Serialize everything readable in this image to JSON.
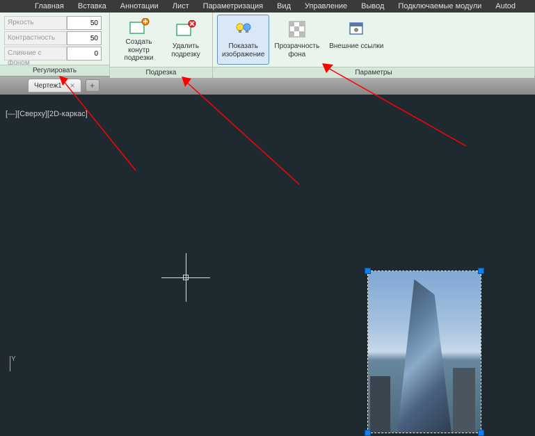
{
  "menubar": {
    "items": [
      "Главная",
      "Вставка",
      "Аннотации",
      "Лист",
      "Параметризация",
      "Вид",
      "Управление",
      "Вывод",
      "Подключаемые модули",
      "Autod"
    ]
  },
  "ribbon": {
    "adjust": {
      "label": "Регулировать",
      "brightness_label": "Яркость",
      "brightness_value": "50",
      "contrast_label": "Контрастность",
      "contrast_value": "50",
      "fade_label": "Слияние с фоном",
      "fade_value": "0"
    },
    "clip": {
      "label": "Подрезка",
      "create_clip": "Создать конутр\nподрезки",
      "remove_clip": "Удалить\nподрезку"
    },
    "params": {
      "label": "Параметры",
      "show_image": "Показать\nизображение",
      "bg_transparency": "Прозрачность\nфона",
      "external_refs": "Внешние ссылки"
    }
  },
  "tabs": {
    "doc1": "Чертеж1*"
  },
  "canvas": {
    "view_label": "[—][Сверху][2D-каркас]",
    "ucs_y": "Y"
  }
}
